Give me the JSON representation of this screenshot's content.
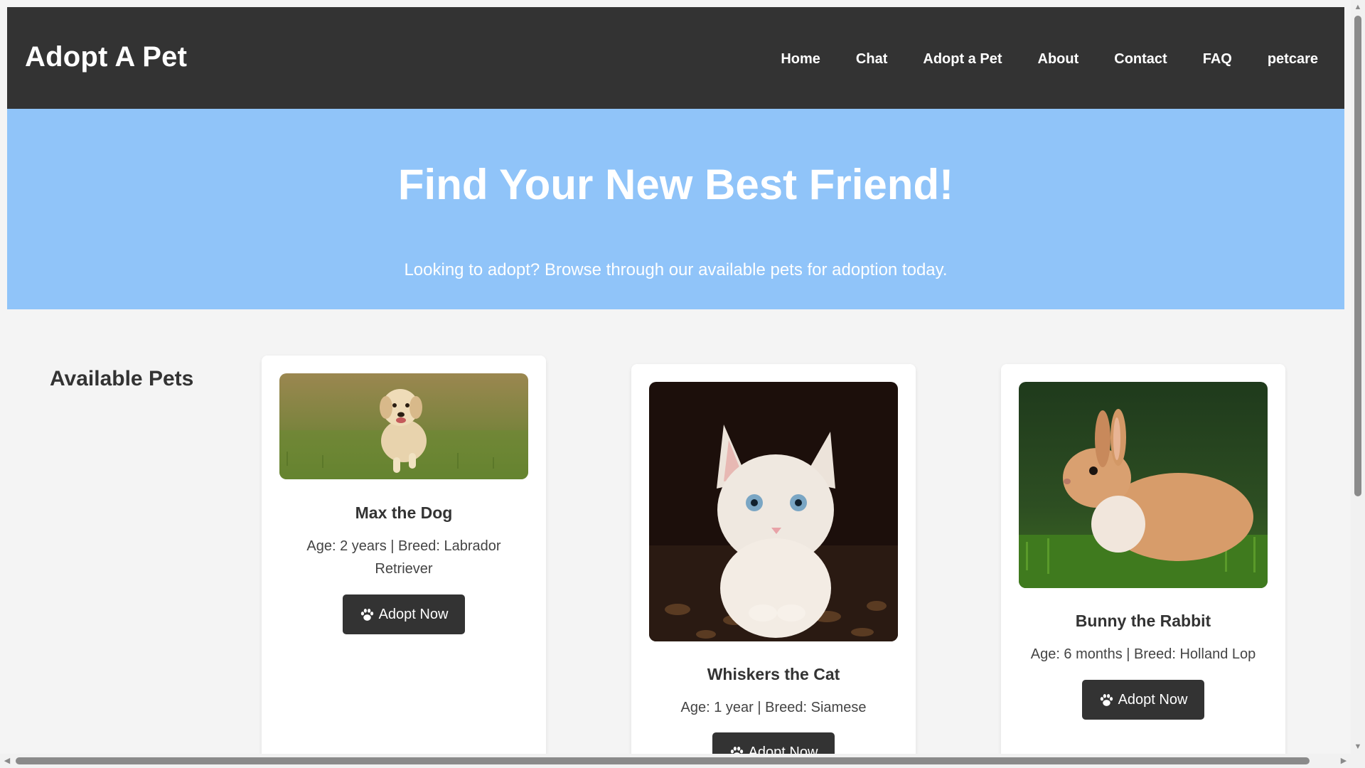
{
  "header": {
    "brand": "Adopt A Pet",
    "nav": [
      "Home",
      "Chat",
      "Adopt a Pet",
      "About",
      "Contact",
      "FAQ",
      "petcare"
    ]
  },
  "hero": {
    "title": "Find Your New Best Friend!",
    "subtitle": "Looking to adopt? Browse through our available pets for adoption today."
  },
  "pets_section": {
    "title": "Available Pets",
    "pets": [
      {
        "name": "Max the Dog",
        "info": "Age: 2 years | Breed: Labrador Retriever",
        "button": "Adopt Now",
        "photo_icon": "dog-photo"
      },
      {
        "name": "Whiskers the Cat",
        "info": "Age: 1 year | Breed: Siamese",
        "button": "Adopt Now",
        "photo_icon": "cat-photo"
      },
      {
        "name": "Bunny the Rabbit",
        "info": "Age: 6 months | Breed: Holland Lop",
        "button": "Adopt Now",
        "photo_icon": "rabbit-photo"
      }
    ]
  },
  "colors": {
    "header_bg": "#333333",
    "hero_bg": "#90c4f9",
    "page_bg": "#f4f4f4",
    "button_bg": "#333333"
  }
}
